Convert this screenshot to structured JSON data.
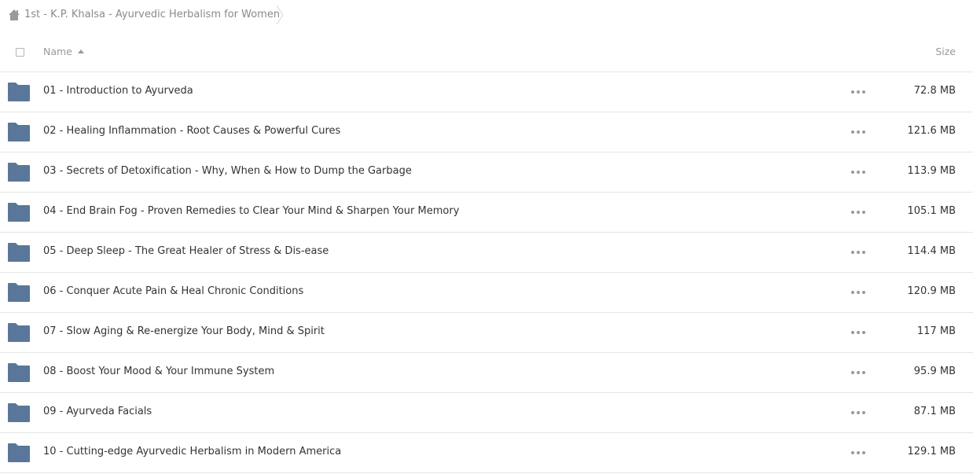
{
  "breadcrumb": {
    "home_icon": "home-icon",
    "label": "1st - K.P. Khalsa - Ayurvedic Herbalism for Women"
  },
  "header": {
    "name_label": "Name",
    "sort_icon": "sort-ascending-icon",
    "size_label": "Size"
  },
  "colors": {
    "folder": "#5b769b",
    "divider": "#e5e5e5",
    "muted_text": "#999999"
  },
  "rows": [
    {
      "name": "01 - Introduction to Ayurveda",
      "size": "72.8 MB"
    },
    {
      "name": "02 - Healing Inflammation - Root Causes & Powerful Cures",
      "size": "121.6 MB"
    },
    {
      "name": "03 - Secrets of Detoxification - Why, When & How to Dump the Garbage",
      "size": "113.9 MB"
    },
    {
      "name": "04 - End Brain Fog - Proven Remedies to Clear Your Mind & Sharpen Your Memory",
      "size": "105.1 MB"
    },
    {
      "name": "05 - Deep Sleep - The Great Healer of Stress & Dis-ease",
      "size": "114.4 MB"
    },
    {
      "name": "06 - Conquer Acute Pain & Heal Chronic Conditions",
      "size": "120.9 MB"
    },
    {
      "name": "07 - Slow Aging & Re-energize Your Body, Mind & Spirit",
      "size": "117 MB"
    },
    {
      "name": "08 - Boost Your Mood & Your Immune System",
      "size": "95.9 MB"
    },
    {
      "name": "09 - Ayurveda Facials",
      "size": "87.1 MB"
    },
    {
      "name": "10 - Cutting-edge Ayurvedic Herbalism in Modern America",
      "size": "129.1 MB"
    }
  ]
}
